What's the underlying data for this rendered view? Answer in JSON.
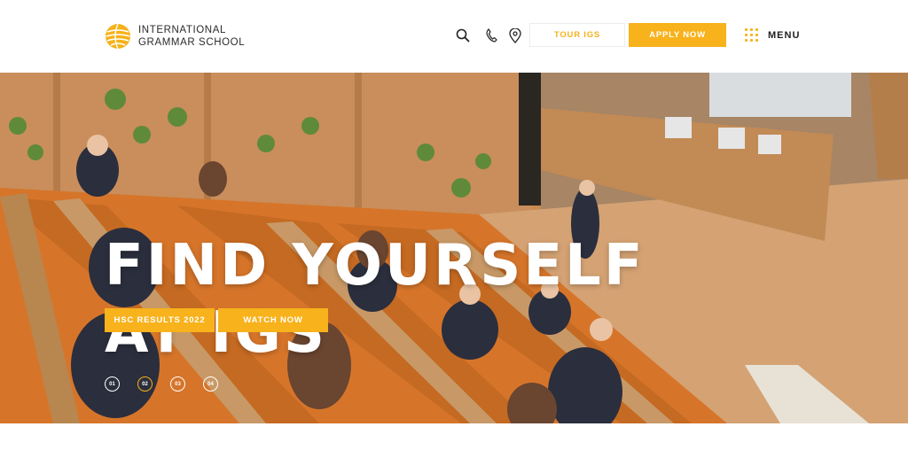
{
  "header": {
    "logo_line1": "INTERNATIONAL",
    "logo_line2": "GRAMMAR SCHOOL",
    "icons": [
      "search-icon",
      "phone-icon",
      "location-pin-icon"
    ],
    "tour_label": "TOUR IGS",
    "apply_label": "APPLY NOW",
    "menu_label": "MENU"
  },
  "hero": {
    "title_line1": "FIND YOURSELF",
    "title_line2": "AT IGS",
    "cta_results": "HSC RESULTS 2022",
    "cta_watch": "WATCH NOW",
    "slides": [
      "01",
      "02",
      "03",
      "04"
    ],
    "active_slide": "02"
  },
  "colors": {
    "accent": "#f7b21c",
    "text_dark": "#2b2b2b",
    "hero_text": "#ffffff"
  }
}
